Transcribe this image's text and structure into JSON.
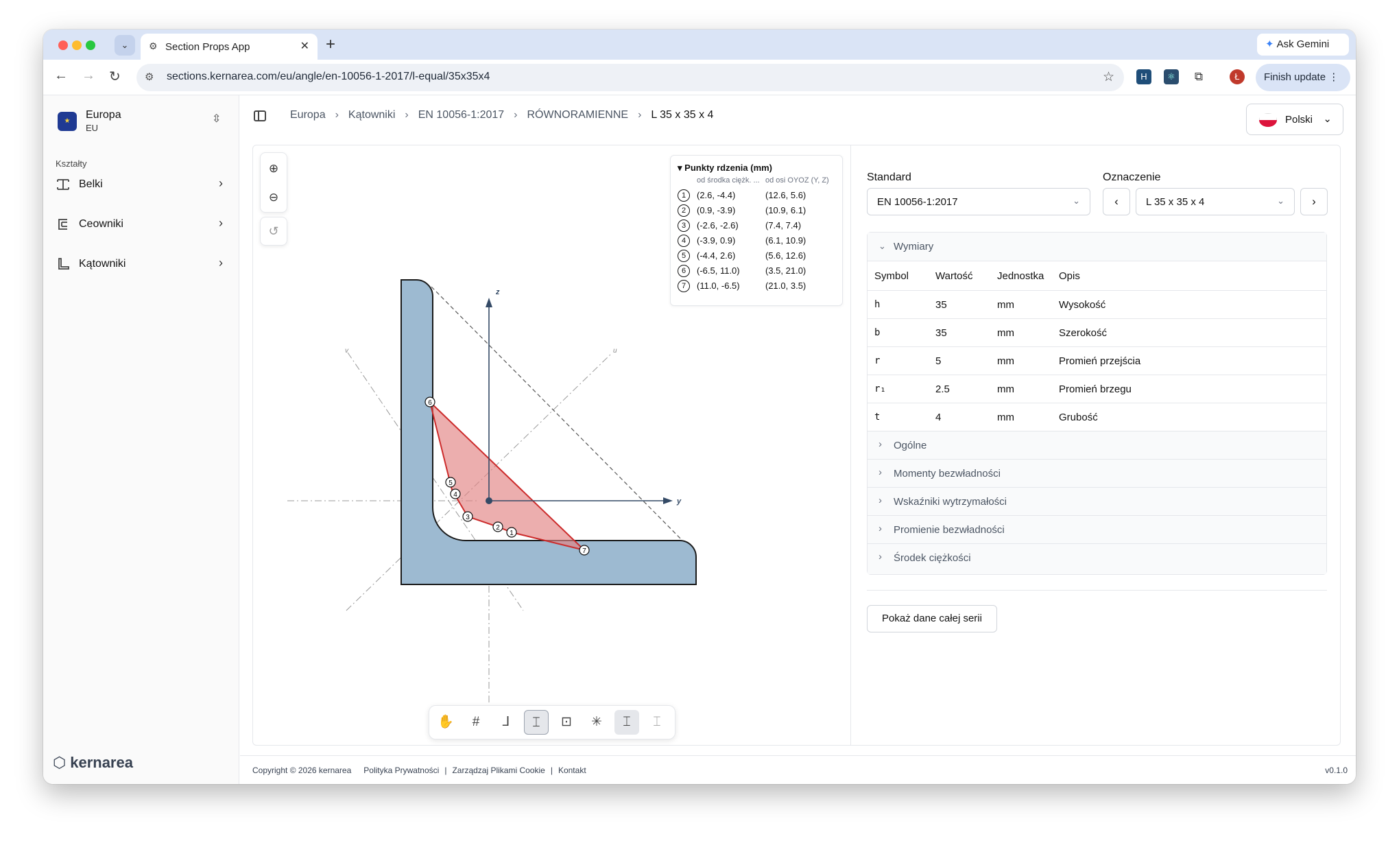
{
  "browser": {
    "tab_title": "Section Props App",
    "url": "sections.kernarea.com/eu/angle/en-10056-1-2017/l-equal/35x35x4",
    "ask_gemini": "Ask Gemini",
    "finish_update": "Finish update",
    "profile_initial": "Ł"
  },
  "sidebar": {
    "workspace_name": "Europa",
    "workspace_code": "EU",
    "section_label": "Kształty",
    "items": [
      {
        "label": "Belki"
      },
      {
        "label": "Ceowniki"
      },
      {
        "label": "Kątowniki"
      }
    ],
    "logo": "kernarea"
  },
  "header": {
    "breadcrumbs": [
      "Europa",
      "Kątowniki",
      "EN 10056-1:2017",
      "RÓWNORAMIENNE",
      "L 35 x 35 x 4"
    ],
    "language": "Polski"
  },
  "diagram": {
    "axis_z": "z",
    "axis_y": "y",
    "axis_u": "u",
    "axis_v": "v",
    "legend": {
      "title": "Punkty rdzenia (mm)",
      "col1": "od środka ciężk. ...",
      "col2": "od osi OYOZ (Y, Z)",
      "rows": [
        {
          "n": "1",
          "a": "(2.6, -4.4)",
          "b": "(12.6, 5.6)"
        },
        {
          "n": "2",
          "a": "(0.9, -3.9)",
          "b": "(10.9, 6.1)"
        },
        {
          "n": "3",
          "a": "(-2.6, -2.6)",
          "b": "(7.4, 7.4)"
        },
        {
          "n": "4",
          "a": "(-3.9, 0.9)",
          "b": "(6.1, 10.9)"
        },
        {
          "n": "5",
          "a": "(-4.4, 2.6)",
          "b": "(5.6, 12.6)"
        },
        {
          "n": "6",
          "a": "(-6.5, 11.0)",
          "b": "(3.5, 21.0)"
        },
        {
          "n": "7",
          "a": "(11.0, -6.5)",
          "b": "(21.0, 3.5)"
        }
      ]
    },
    "toolbar_icons": [
      "hand-icon",
      "grid-icon",
      "axes-icon",
      "dimensions-icon",
      "centroid-icon",
      "principal-axes-icon",
      "core-icon",
      "section-shape-icon"
    ]
  },
  "properties": {
    "standard_label": "Standard",
    "standard_value": "EN 10056-1:2017",
    "designation_label": "Oznaczenie",
    "designation_value": "L 35 x 35 x 4",
    "dimensions_title": "Wymiary",
    "columns": [
      "Symbol",
      "Wartość",
      "Jednostka",
      "Opis"
    ],
    "rows": [
      {
        "symbol": "h",
        "value": "35",
        "unit": "mm",
        "desc": "Wysokość"
      },
      {
        "symbol": "b",
        "value": "35",
        "unit": "mm",
        "desc": "Szerokość"
      },
      {
        "symbol": "r",
        "value": "5",
        "unit": "mm",
        "desc": "Promień przejścia"
      },
      {
        "symbol": "r₁",
        "value": "2.5",
        "unit": "mm",
        "desc": "Promień brzegu"
      },
      {
        "symbol": "t",
        "value": "4",
        "unit": "mm",
        "desc": "Grubość"
      }
    ],
    "sections": [
      "Ogólne",
      "Momenty bezwładności",
      "Wskaźniki wytrzymałości",
      "Promienie bezwładności",
      "Środek ciężkości"
    ],
    "series_button": "Pokaż dane całej serii"
  },
  "footer": {
    "copyright": "Copyright © 2026 kernarea",
    "links": [
      "Polityka Prywatności",
      "Zarządzaj Plikami Cookie",
      "Kontakt"
    ],
    "version": "v0.1.0"
  },
  "colors": {
    "section_fill": "#9dbad1",
    "core_fill": "#e8a4a4",
    "core_stroke": "#cc2b2b",
    "axis": "#344a66"
  }
}
